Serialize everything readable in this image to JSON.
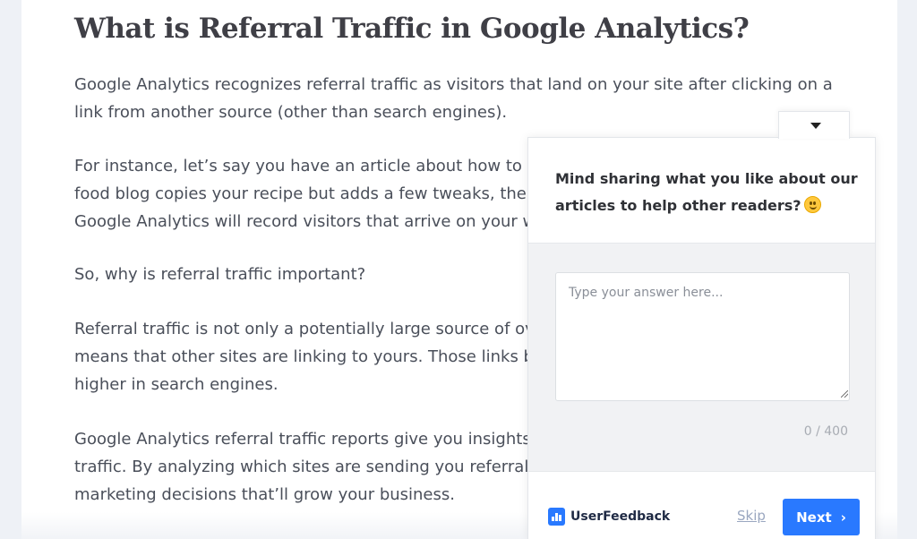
{
  "article": {
    "title": "What is Referral Traffic in Google Analytics?",
    "paragraphs": [
      [
        "Google Analytics recognizes referral traffic as visitors that land on your site after clicking on a",
        "link from another source (other than search engines)."
      ],
      [
        "For instance, let’s say you have an article about how to m",
        "food blog copies your recipe but adds a few tweaks, ther",
        "Google Analytics will record visitors that arrive on your w"
      ],
      [
        "So, why is referral traffic important?"
      ],
      [
        "Referral traffic is not only a potentially large source of ov",
        "means that other sites are linking to yours. Those links b",
        "higher in search engines."
      ],
      [
        "Google Analytics referral traffic reports give you insights",
        "traffic. By analyzing which sites are sending you referral t",
        "marketing decisions that’ll grow your business."
      ]
    ]
  },
  "widget": {
    "question_lines": [
      "Mind sharing what you like about our",
      "articles to help other readers?"
    ],
    "emoji_icon": "slightly-smiling-face-icon",
    "answer_placeholder": "Type your answer here...",
    "answer_value": "",
    "char_count": "0 / 400",
    "brand_name": "UserFeedback",
    "skip_label": "Skip",
    "next_label": "Next",
    "next_icon": "chevron-right-icon",
    "collapse_icon": "caret-down-icon",
    "accent_color": "#2979ff"
  }
}
